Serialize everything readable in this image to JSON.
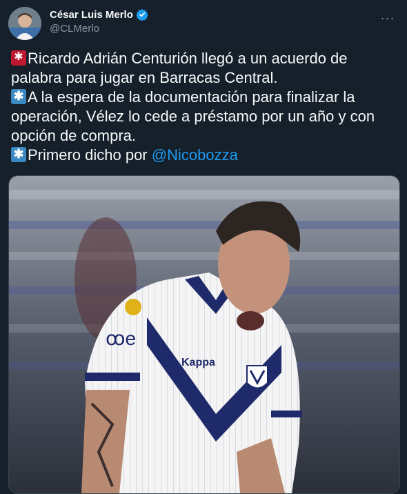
{
  "author": {
    "display_name": "César Luis Merlo",
    "handle": "@CLMerlo",
    "verified": true,
    "avatar_icon": "profile-photo",
    "verified_icon": "verified-badge-icon"
  },
  "menu": {
    "icon": "more-options-icon",
    "glyph": "···"
  },
  "tweet": {
    "line1": "Ricardo Adrián Centurión llegó a un acuerdo de",
    "line2": "palabra para jugar en Barracas Central.",
    "line3": "A la espera de la documentación para finalizar la",
    "line4": "operación, Vélez lo cede a préstamo por un año y con",
    "line5": "opción de compra.",
    "line6_prefix": "Primero dicho por ",
    "mention": "@Nicobozza"
  },
  "media": {
    "icon": "photo",
    "shirt_sponsor": "ꝏe",
    "shirt_brand": "Kappa"
  },
  "colors": {
    "background": "#15202b",
    "text": "#f7f9f9",
    "muted": "#8b98a5",
    "link": "#1d9bf0",
    "siren_emoji": "#be1931",
    "asterisk_emoji": "#3b88c3"
  }
}
